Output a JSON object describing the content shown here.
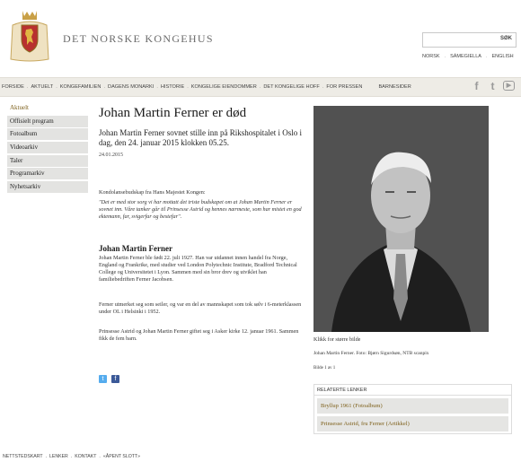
{
  "header": {
    "site_title": "DET NORSKE KONGEHUS",
    "search_button": "SØK",
    "search_value": "",
    "languages": [
      "NORSK",
      "SÁMEGIELLA",
      "ENGLISH"
    ]
  },
  "nav": {
    "items": [
      "FORSIDE",
      "AKTUELT",
      "KONGEFAMILIEN",
      "DAGENS MONARKI",
      "HISTORIE",
      "KONGELIGE EIENDOMMER",
      "DET KONGELIGE HOFF",
      "FOR PRESSEN",
      "BARNESIDER"
    ],
    "social_icons": [
      "facebook-icon",
      "twitter-icon",
      "youtube-icon"
    ]
  },
  "sidebar": {
    "items": [
      "Aktuelt",
      "Offisielt program",
      "Fotoalbum",
      "Videoarkiv",
      "Taler",
      "Programarkiv",
      "Nyhetsarkiv"
    ],
    "active_index": 0
  },
  "article": {
    "title": "Johan Martin Ferner er død",
    "lead": "Johan Martin Ferner sovnet stille inn på Rikshospitalet i Oslo i dag, den 24. januar 2015 klokken 05.25.",
    "date": "24.01.2015",
    "condolence_label": "Kondolansebudskap fra Hans Majestet Kongen:",
    "quote": "\"Det er med stor sorg vi har mottatt det triste budskapet om at Johan Martin Ferner er sovnet inn. Våre tanker går til Prinsesse Astrid og hennes nærmeste, som har mistet en god ektemann, far, svigerfar og bestefar\".",
    "section_heading": "Johan Martin Ferner",
    "para1": "Johan Martin Ferner ble født 22. juli 1927. Han var utdannet innen handel fra Norge, England og Frankrike, med studier ved London Polytechnic Institute, Bradford Technical College og Universitetet i Lyon. Sammen med sin bror drev og utviklet han familiebedriften Ferner Jacobsen.",
    "para2": "Ferner utmerket seg som seiler, og var en del av mannskapet som tok sølv i 6-meterklassen under OL i Helsinki i 1952.",
    "para3": "Prinsesse Astrid og Johan Martin Ferner giftet seg i Asker kirke 12. januar 1961. Sammen fikk de fem barn."
  },
  "photo": {
    "caption_link": "Klikk for større bilde",
    "credit": "Johan Martin Ferner. Foto: Bjørn Sigurdsøn, NTB scanpix",
    "count": "Bilde 1 av 1"
  },
  "related": {
    "heading": "RELATERTE LENKER",
    "links": [
      "Bryllup 1961 (Fotoalbum)",
      "Prinsesse Astrid, fru Ferner (Artikkel)"
    ]
  },
  "footer": {
    "links": [
      "NETTSTEDSKART",
      "LENKER",
      "KONTAKT",
      "«ÅPENT SLOTT»"
    ]
  },
  "colors": {
    "accent": "#7d5f19",
    "nav_bg": "#eeece6",
    "sidebar_bg": "#e3e3e1"
  }
}
